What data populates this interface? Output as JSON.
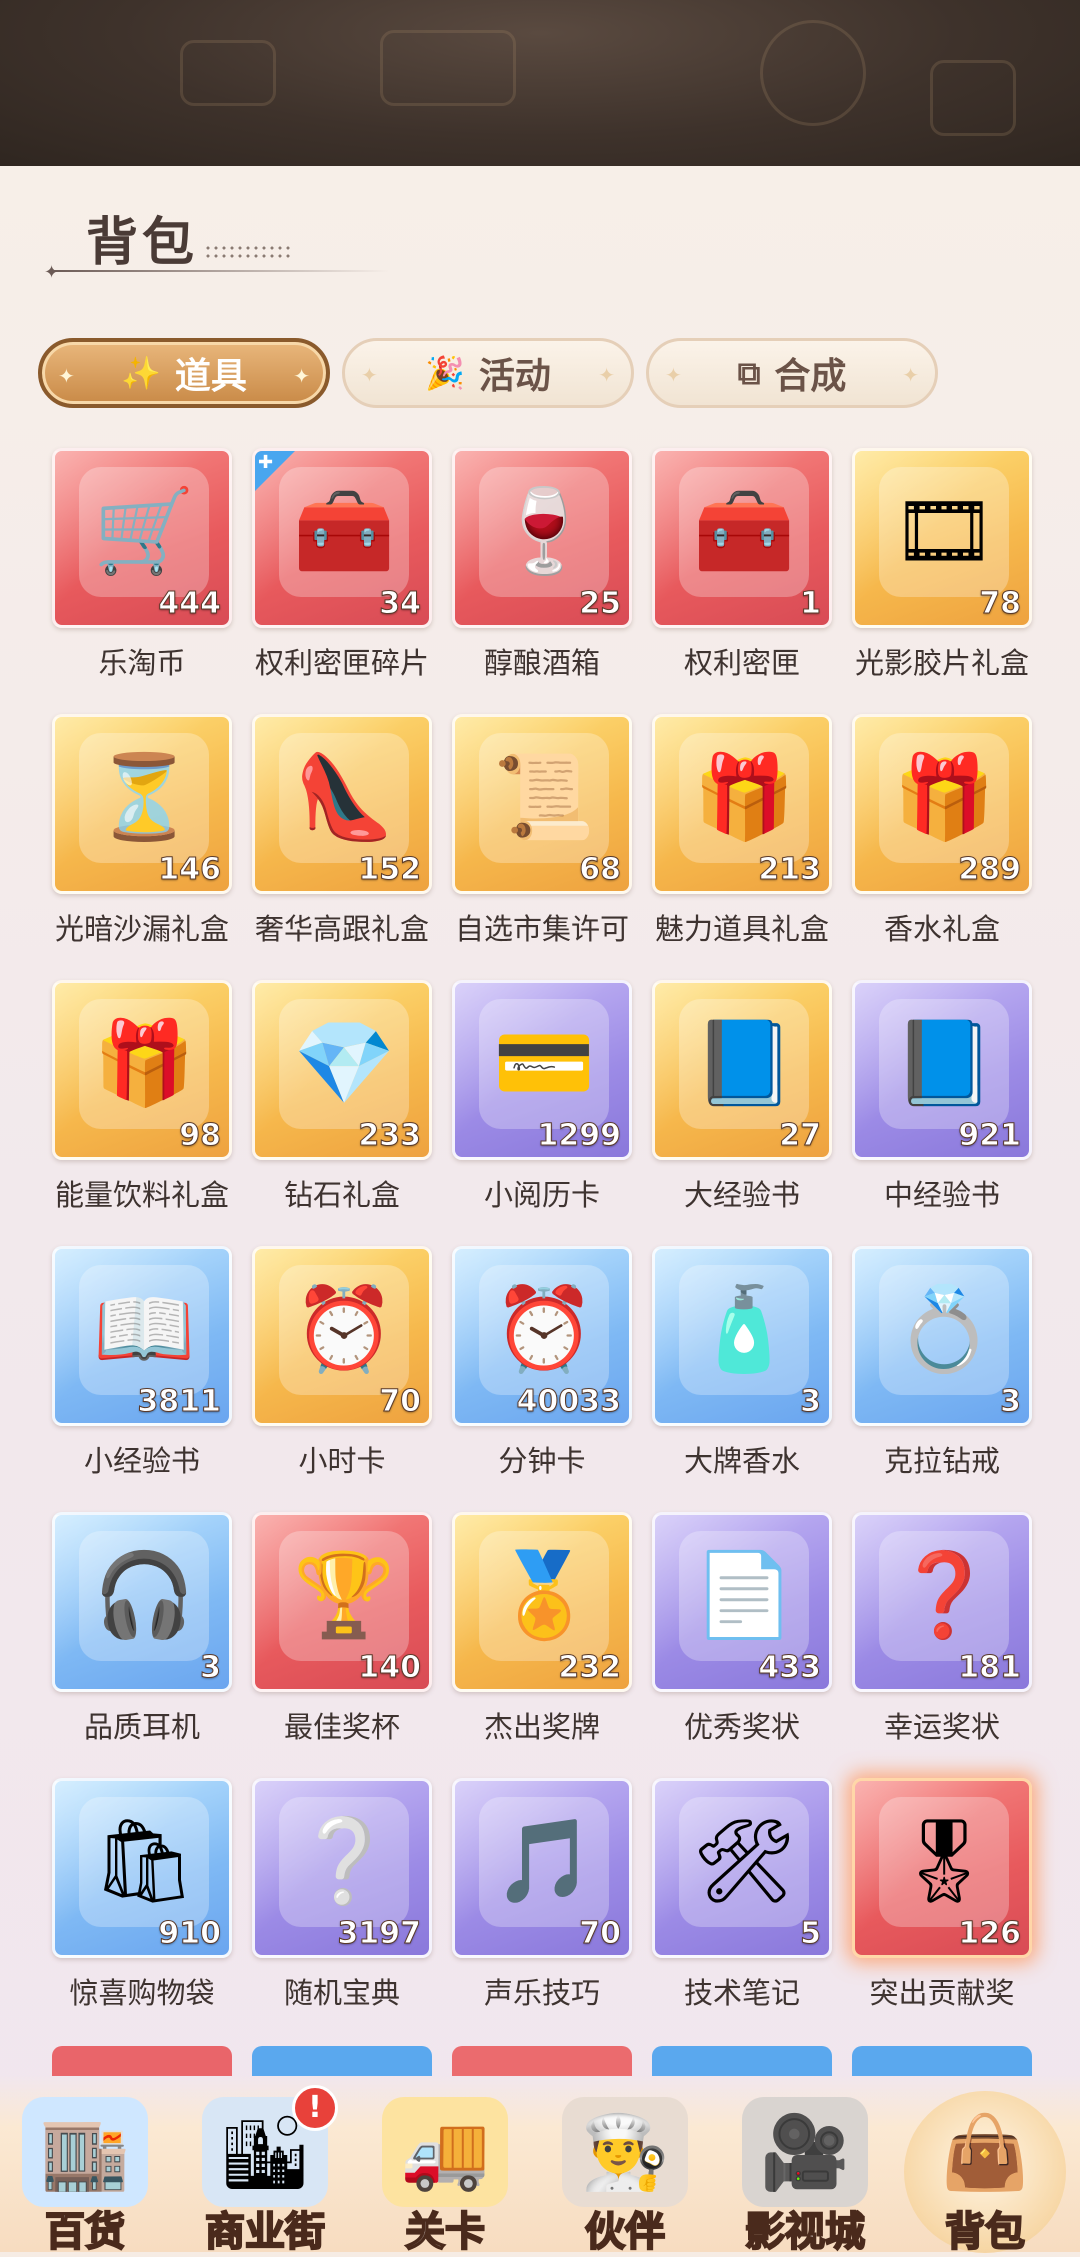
{
  "page": {
    "title": "背包"
  },
  "tabs": [
    {
      "label": "道具",
      "icon": "magic-wand-icon",
      "active": true
    },
    {
      "label": "活动",
      "icon": "party-popper-icon",
      "active": false
    },
    {
      "label": "合成",
      "icon": "merge-squares-icon",
      "active": false
    }
  ],
  "items": [
    {
      "name": "乐淘币",
      "count": "444",
      "icon": "shopping-cart-coin-icon",
      "glyph": "🛒",
      "color": "red"
    },
    {
      "name": "权利密匣碎片",
      "count": "34",
      "icon": "treasure-chest-fragment-icon",
      "glyph": "🧰",
      "color": "red",
      "badge": true
    },
    {
      "name": "醇酿酒箱",
      "count": "25",
      "icon": "wine-basket-icon",
      "glyph": "🍷",
      "color": "red"
    },
    {
      "name": "权利密匣",
      "count": "1",
      "icon": "treasure-chest-icon",
      "glyph": "🧰",
      "color": "red"
    },
    {
      "name": "光影胶片礼盒",
      "count": "78",
      "icon": "film-gift-box-icon",
      "glyph": "🎞",
      "color": "gold"
    },
    {
      "name": "光暗沙漏礼盒",
      "count": "146",
      "icon": "hourglass-gift-box-icon",
      "glyph": "⏳",
      "color": "gold"
    },
    {
      "name": "奢华高跟礼盒",
      "count": "152",
      "icon": "high-heels-gift-box-icon",
      "glyph": "👠",
      "color": "gold"
    },
    {
      "name": "自选市集许可",
      "count": "68",
      "icon": "market-permit-icon",
      "glyph": "📜",
      "color": "gold"
    },
    {
      "name": "魅力道具礼盒",
      "count": "213",
      "icon": "charm-gift-box-icon",
      "glyph": "🎁",
      "color": "gold"
    },
    {
      "name": "香水礼盒",
      "count": "289",
      "icon": "perfume-gift-box-icon",
      "glyph": "🎁",
      "color": "gold"
    },
    {
      "name": "能量饮料礼盒",
      "count": "98",
      "icon": "energy-drink-gift-box-icon",
      "glyph": "🎁",
      "color": "gold"
    },
    {
      "name": "钻石礼盒",
      "count": "233",
      "icon": "diamond-gift-box-icon",
      "glyph": "💎",
      "color": "gold"
    },
    {
      "name": "小阅历卡",
      "count": "1299",
      "icon": "experience-card-icon",
      "glyph": "💳",
      "color": "purple"
    },
    {
      "name": "大经验书",
      "count": "27",
      "icon": "large-experience-book-icon",
      "glyph": "📘",
      "color": "gold"
    },
    {
      "name": "中经验书",
      "count": "921",
      "icon": "medium-experience-book-icon",
      "glyph": "📘",
      "color": "purple"
    },
    {
      "name": "小经验书",
      "count": "3811",
      "icon": "small-experience-book-icon",
      "glyph": "📖",
      "color": "blue"
    },
    {
      "name": "小时卡",
      "count": "70",
      "icon": "hour-card-icon",
      "glyph": "⏰",
      "color": "gold"
    },
    {
      "name": "分钟卡",
      "count": "40033",
      "icon": "minute-card-icon",
      "glyph": "⏰",
      "color": "blue"
    },
    {
      "name": "大牌香水",
      "count": "3",
      "icon": "perfume-bottle-icon",
      "glyph": "🧴",
      "color": "blue"
    },
    {
      "name": "克拉钻戒",
      "count": "3",
      "icon": "diamond-ring-icon",
      "glyph": "💍",
      "color": "blue"
    },
    {
      "name": "品质耳机",
      "count": "3",
      "icon": "headphones-icon",
      "glyph": "🎧",
      "color": "blue"
    },
    {
      "name": "最佳奖杯",
      "count": "140",
      "icon": "trophy-icon",
      "glyph": "🏆",
      "color": "red"
    },
    {
      "name": "杰出奖牌",
      "count": "232",
      "icon": "medal-icon",
      "glyph": "🏅",
      "color": "gold"
    },
    {
      "name": "优秀奖状",
      "count": "433",
      "icon": "certificate-icon",
      "glyph": "📄",
      "color": "purple"
    },
    {
      "name": "幸运奖状",
      "count": "181",
      "icon": "lucky-card-icon",
      "glyph": "❓",
      "color": "purple"
    },
    {
      "name": "惊喜购物袋",
      "count": "910",
      "icon": "surprise-bag-icon",
      "glyph": "🛍",
      "color": "blue"
    },
    {
      "name": "随机宝典",
      "count": "3197",
      "icon": "random-book-icon",
      "glyph": "❔",
      "color": "purple"
    },
    {
      "name": "声乐技巧",
      "count": "70",
      "icon": "music-note-icon",
      "glyph": "🎵",
      "color": "purple"
    },
    {
      "name": "技术笔记",
      "count": "5",
      "icon": "tech-notes-icon",
      "glyph": "🛠",
      "color": "purple"
    },
    {
      "name": "突出贡献奖",
      "count": "126",
      "icon": "reward-certificate-icon",
      "glyph": "🎖",
      "color": "red",
      "glow": true
    }
  ],
  "bottom_nav": [
    {
      "label": "百货",
      "icon": "department-store-icon",
      "glyph": "🏬",
      "active": false,
      "badge": ""
    },
    {
      "label": "商业街",
      "icon": "commercial-street-icon",
      "glyph": "🏙",
      "active": false,
      "badge": "!"
    },
    {
      "label": "关卡",
      "icon": "delivery-truck-icon",
      "glyph": "🚚",
      "active": false,
      "badge": ""
    },
    {
      "label": "伙伴",
      "icon": "partner-chef-icon",
      "glyph": "👨‍🍳",
      "active": false,
      "badge": ""
    },
    {
      "label": "影视城",
      "icon": "film-reel-icon",
      "glyph": "🎥",
      "active": false,
      "badge": ""
    },
    {
      "label": "背包",
      "icon": "handbag-icon",
      "glyph": "👜",
      "active": true,
      "badge": ""
    }
  ]
}
